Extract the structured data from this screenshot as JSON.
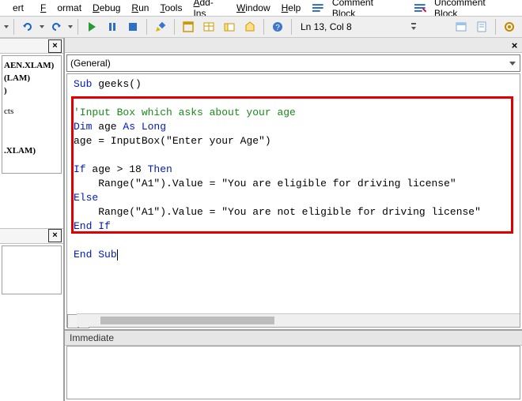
{
  "menu": {
    "items": [
      "ert",
      "Format",
      "Debug",
      "Run",
      "Tools",
      "Add-Ins",
      "Window",
      "Help"
    ],
    "extra": [
      "Comment Block",
      "Uncomment Block"
    ]
  },
  "toolbar": {
    "status": "Ln 13, Col 8"
  },
  "combo": {
    "value": "(General)"
  },
  "tree": {
    "l1": "AEN.XLAM)",
    "l2": "(LAM)",
    "l3": ")",
    "l4": "cts",
    "l5": ".XLAM)"
  },
  "code": {
    "l1a": "Sub",
    "l1b": " geeks()",
    "l3": "'Input Box which asks about your age",
    "l4a": "Dim",
    "l4b": " age ",
    "l4c": "As Long",
    "l5a": "age = InputBox(",
    "l5b": "\"Enter your Age\"",
    "l5c": ")",
    "l7a": "If",
    "l7b": " age > 18 ",
    "l7c": "Then",
    "l8a": "    Range(",
    "l8b": "\"A1\"",
    "l8c": ").Value = ",
    "l8d": "\"You are eligible for driving license\"",
    "l9": "Else",
    "l10a": "    Range(",
    "l10b": "\"A1\"",
    "l10c": ").Value = ",
    "l10d": "\"You are not eligible for driving license\"",
    "l11a": "End",
    "l11b": " ",
    "l11c": "If",
    "l13a": "End",
    "l13b": " ",
    "l13c": "Sub"
  },
  "immediate": {
    "title": "Immediate"
  }
}
